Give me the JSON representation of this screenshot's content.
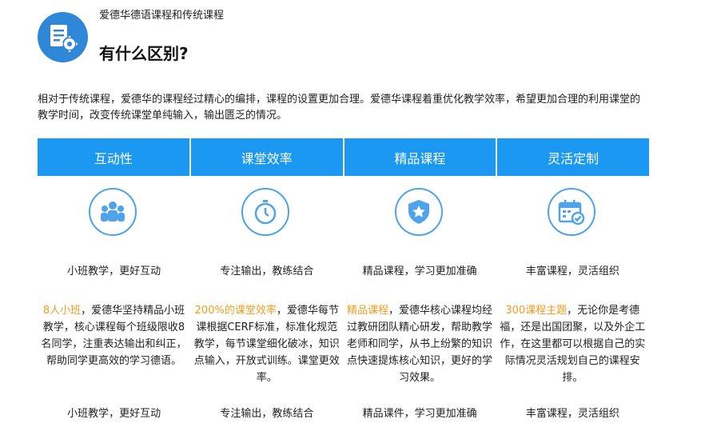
{
  "header": {
    "subtitle": "爱德华德语课程和传统课程",
    "title": "有什么区别?"
  },
  "intro": "相对于传统课程，爱德华的课程经过精心的编排，课程的设置更加合理。爱德华课程着重优化教学效率，希望更加合理的利用课堂的教学时间，改变传统课堂单纯输入，输出匮乏的情况。",
  "tabs": [
    "互动性",
    "课堂效率",
    "精品课程",
    "灵活定制"
  ],
  "columns": [
    {
      "icon": "group-icon",
      "tagline": "小班教学，更好互动",
      "highlight": "8人小班",
      "desc": "，爱德华坚持精品小班教学，核心课程每个班级限收8名同学，注重表达输出和纠正，帮助同学更高效的学习德语。",
      "footer": "小班教学，更好互动"
    },
    {
      "icon": "stopwatch-icon",
      "tagline": "专注输出，教练结合",
      "highlight": "200%的课堂效率",
      "desc": "，爱德华每节课根据CERF标准，标准化规范教学，每节课堂细化破冰，知识点输入，开放式训练。课堂更效率。",
      "footer": "专注输出，教练结合"
    },
    {
      "icon": "star-shield-icon",
      "tagline": "精品课程，学习更加准确",
      "highlight": "精品课程",
      "desc": "，爱德华核心课程均经过教研团队精心研发，帮助教学老师和同学，从书上纷繁的知识点快速提炼核心知识，更好的学习效果。",
      "footer": "精品课件，学习更加准确"
    },
    {
      "icon": "calendar-check-icon",
      "tagline": "丰富课程，灵活组织",
      "highlight": "300课程主题",
      "desc": "，无论你是考德福，还是出国团聚，以及外企工作，在这里都可以根据自己的实际情况灵活规划自己的课程安排。",
      "footer": "丰富课程，灵活组织"
    }
  ],
  "colors": {
    "accent": "#1b98f1",
    "highlight": "#f39c1f",
    "logo": "#2f87d8"
  }
}
